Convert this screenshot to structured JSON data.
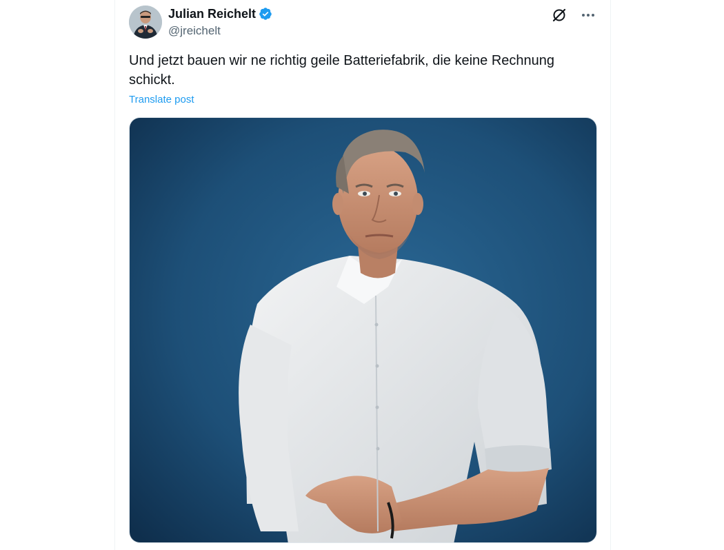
{
  "post": {
    "author": {
      "display_name": "Julian Reichelt",
      "handle": "@jreichelt",
      "verified": true,
      "avatar_icon": "avatar-photo"
    },
    "text": "Und jetzt bauen wir ne richtig geile Batteriefabrik, die keine Rechnung schickt.",
    "translate_label": "Translate post",
    "actions": {
      "grok_icon": "grok-icon",
      "more_icon": "more-horizontal-icon"
    },
    "media": {
      "type": "photo",
      "description_icon": "photo-man-white-shirt"
    }
  },
  "colors": {
    "text_primary": "#0f1419",
    "text_secondary": "#536471",
    "link": "#1d9bf0",
    "verified": "#1d9bf0",
    "photo_background": "#1d4f77"
  }
}
